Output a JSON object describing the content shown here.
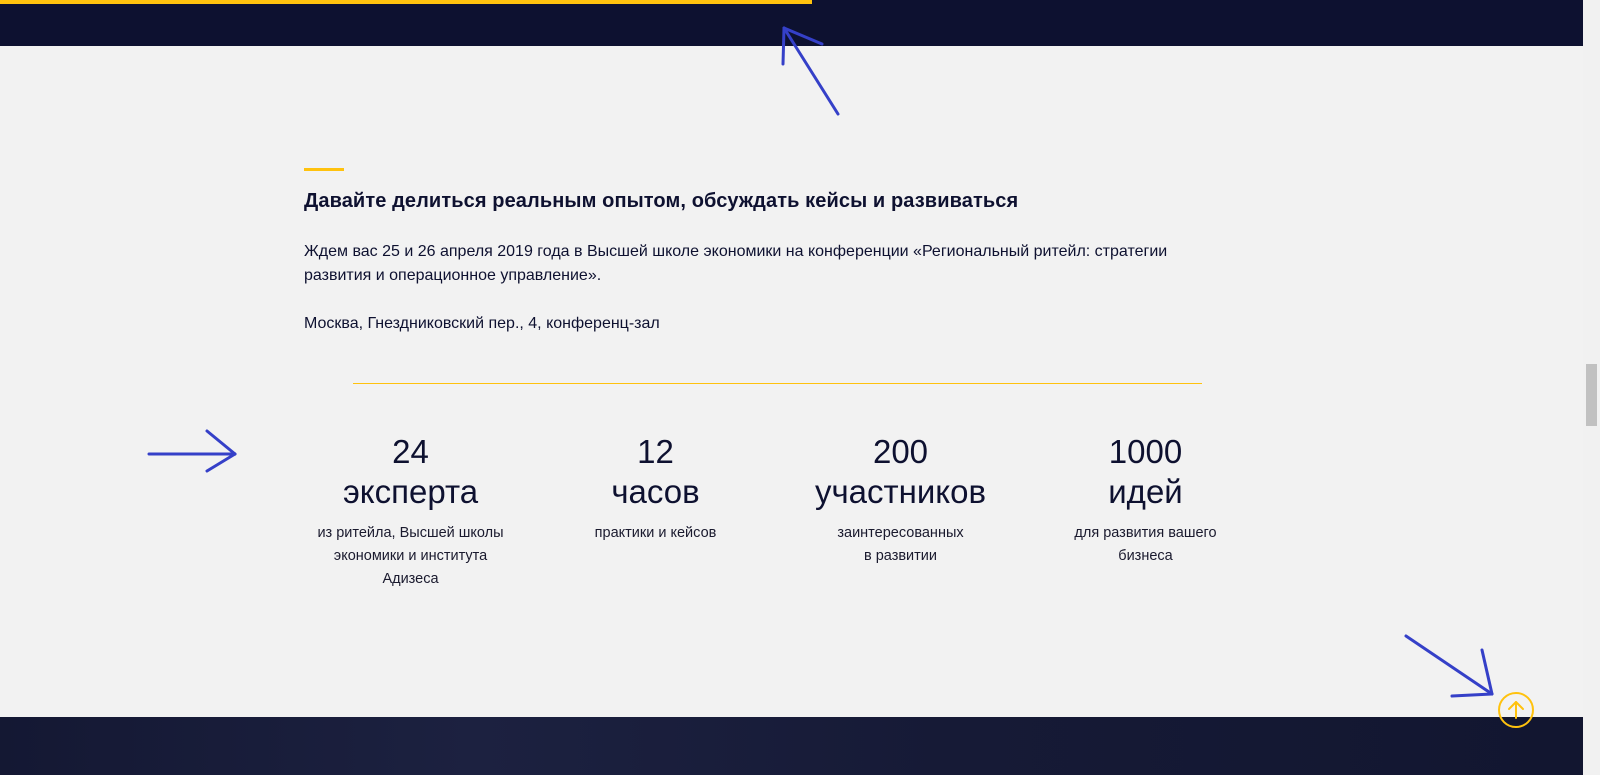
{
  "header": {
    "progress_percent": 51.3,
    "accent_color": "#ffc20e",
    "background_color": "#0d1130"
  },
  "intro": {
    "heading": "Давайте делиться реальным опытом, обсуждать кейсы и развиваться",
    "paragraph": "Ждем вас 25 и 26 апреля 2019 года в Высшей школе экономики на конференции «Региональный ритейл: стратегии развития и операционное управление».",
    "address": "Москва, Гнездниковский пер., 4, конференц-зал"
  },
  "stats": [
    {
      "number": "24",
      "unit": "эксперта",
      "description": "из ритейла, Высшей школы экономики и института Адизеса"
    },
    {
      "number": "12",
      "unit": "часов",
      "description": "практики и кейсов"
    },
    {
      "number": "200",
      "unit": "участников",
      "description": "заинтересованных\nв развитии"
    },
    {
      "number": "1000",
      "unit": "идей",
      "description": "для развития вашего\nбизнеса"
    }
  ],
  "scroll_up": {
    "icon": "arrow-up-icon"
  },
  "annotations": {
    "color": "#3540c8",
    "icon": "hand-drawn-arrow"
  }
}
